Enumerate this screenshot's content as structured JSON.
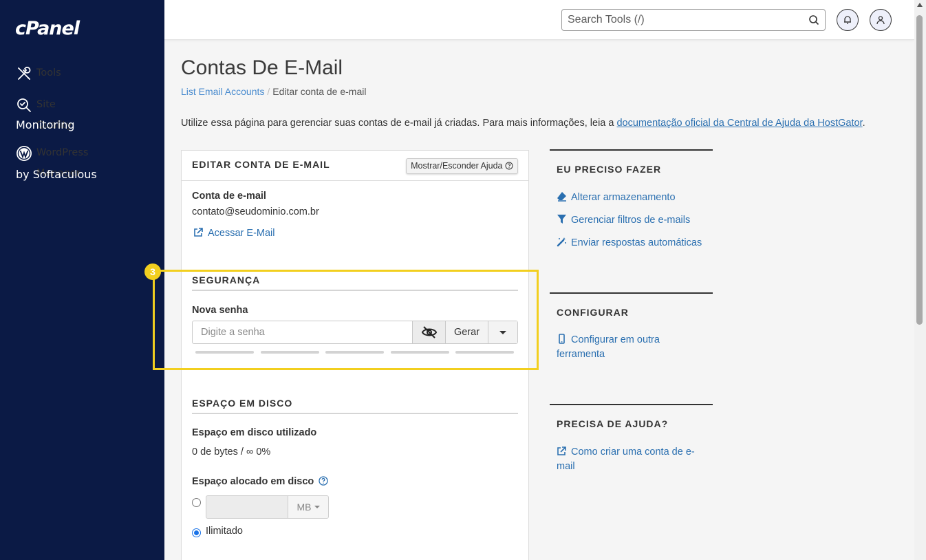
{
  "sidebar": {
    "logo": "cPanel",
    "items": [
      {
        "label": "Tools",
        "icon": "tools-icon"
      },
      {
        "label": "Site Quality",
        "label2": "Monitoring",
        "icon": "site-quality-icon"
      },
      {
        "label": "WordPress Manager",
        "label2": "by Softaculous",
        "icon": "wordpress-icon"
      }
    ]
  },
  "header": {
    "search_placeholder": "Search Tools (/)"
  },
  "page": {
    "title": "Contas De E-Mail",
    "breadcrumb": {
      "parent": "List Email Accounts",
      "separator": "/",
      "current": "Editar conta de e-mail"
    },
    "intro_text": "Utilize essa página para gerenciar suas contas de e-mail já criadas. Para mais informações, leia a ",
    "intro_link": "documentação oficial da Central de Ajuda da HostGator",
    "intro_end": "."
  },
  "panel": {
    "title": "EDITAR CONTA DE E-MAIL",
    "help_button": "Mostrar/Esconder Ajuda",
    "account_label": "Conta de e-mail",
    "account_value": "contato@seudominio.com.br",
    "access_link": "Acessar E-Mail",
    "security": {
      "title": "SEGURANÇA",
      "password_label": "Nova senha",
      "password_placeholder": "Digite a senha",
      "generate_button": "Gerar",
      "strength_segments": 5
    },
    "disk": {
      "title": "ESPAÇO EM DISCO",
      "used_label": "Espaço em disco utilizado",
      "used_value": "0 de bytes / ∞ 0%",
      "allocated_label": "Espaço alocado em disco",
      "unit": "MB",
      "unlimited_label": "Ilimitado",
      "selected": "unlimited"
    }
  },
  "annotation": {
    "step": "3",
    "color": "#f2cf1f"
  },
  "right": {
    "need_to_do": {
      "title": "EU PRECISO FAZER",
      "links": [
        "Alterar armazenamento",
        "Gerenciar filtros de e-mails",
        "Enviar respostas automáticas"
      ]
    },
    "configure": {
      "title": "CONFIGURAR",
      "link_line1": "Configurar em outra",
      "link_line2": "ferramenta"
    },
    "help": {
      "title": "PRECISA DE AJUDA?",
      "link_line1": "Como criar uma conta de e-",
      "link_line2": "mail"
    }
  },
  "colors": {
    "sidebar": "#0b1a45",
    "link": "#2a6fb0",
    "highlight": "#f2cf1f"
  }
}
